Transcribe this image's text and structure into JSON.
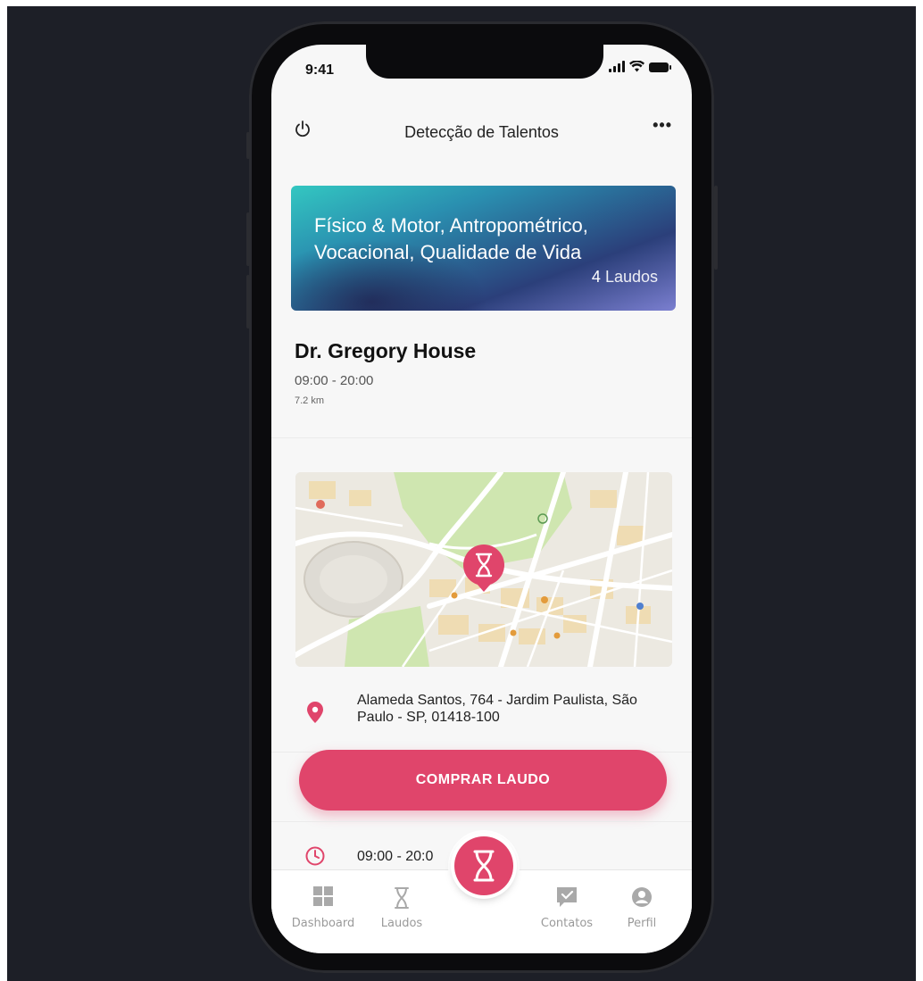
{
  "status_bar": {
    "time": "9:41"
  },
  "header": {
    "title": "Detecção de Talentos",
    "more_label": "•••"
  },
  "banner": {
    "title": "Físico & Motor, Antropométrico, Vocacional, Qualidade de Vida",
    "count": "4",
    "count_unit": "Laudos"
  },
  "doctor": {
    "name": "Dr. Gregory House",
    "hours": "09:00 - 20:00",
    "distance": "7.2 km"
  },
  "address": {
    "text": "Alameda Santos, 764 - Jardim Paulista, São Paulo - SP, 01418-100"
  },
  "buy_button": {
    "label": "COMPRAR LAUDO"
  },
  "hours_row": {
    "text": "09:00 - 20:0"
  },
  "tabbar": {
    "items": [
      {
        "label": "Dashboard",
        "icon": "grid-icon"
      },
      {
        "label": "Laudos",
        "icon": "hourglass-icon"
      },
      {
        "label": "Contatos",
        "icon": "chat-check-icon"
      },
      {
        "label": "Perfil",
        "icon": "user-icon"
      }
    ],
    "center_icon": "dna-icon"
  },
  "colors": {
    "accent": "#e0456b",
    "background": "#1d1f27"
  }
}
